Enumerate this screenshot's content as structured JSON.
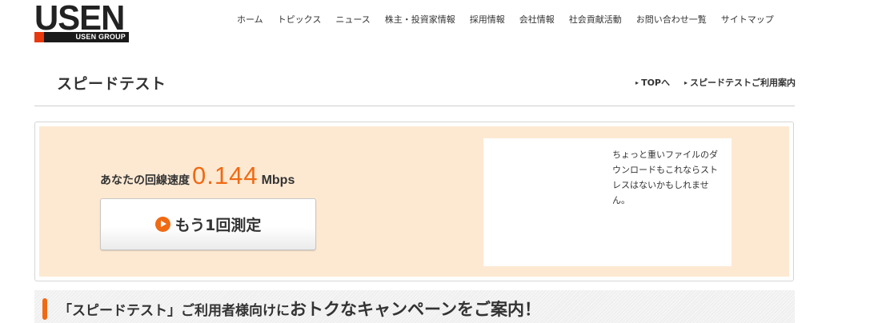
{
  "header": {
    "logo_text": "USEN",
    "logo_subtext": "USEN GROUP",
    "nav": [
      {
        "label": "ホーム"
      },
      {
        "label": "トピックス"
      },
      {
        "label": "ニュース"
      },
      {
        "label": "株主・投資家情報"
      },
      {
        "label": "採用情報"
      },
      {
        "label": "会社情報"
      },
      {
        "label": "社会貢献活動"
      },
      {
        "label": "お問い合わせ一覧"
      },
      {
        "label": "サイトマップ"
      }
    ]
  },
  "page": {
    "title": "スピードテスト",
    "links": [
      {
        "label": "TOPへ"
      },
      {
        "label": "スピードテストご利用案内"
      }
    ]
  },
  "result": {
    "speed_label": "あなたの回線速度",
    "speed_value": "0.144",
    "speed_unit": "Mbps",
    "remeasure_label": "もう1回測定",
    "message": "ちょっと重いファイルのダウンロードもこれならストレスはないかもしれません。"
  },
  "campaign": {
    "text_normal": "「スピードテスト」ご利用者様向けに",
    "text_strong": "おトクなキャンペーンをご案内！"
  },
  "colors": {
    "accent_orange": "#f06a14",
    "panel_background": "#fde9d2",
    "logo_red": "#e8380d"
  },
  "icons": {
    "play": "play-circle-icon",
    "link_arrow": "triangle-right-icon"
  }
}
